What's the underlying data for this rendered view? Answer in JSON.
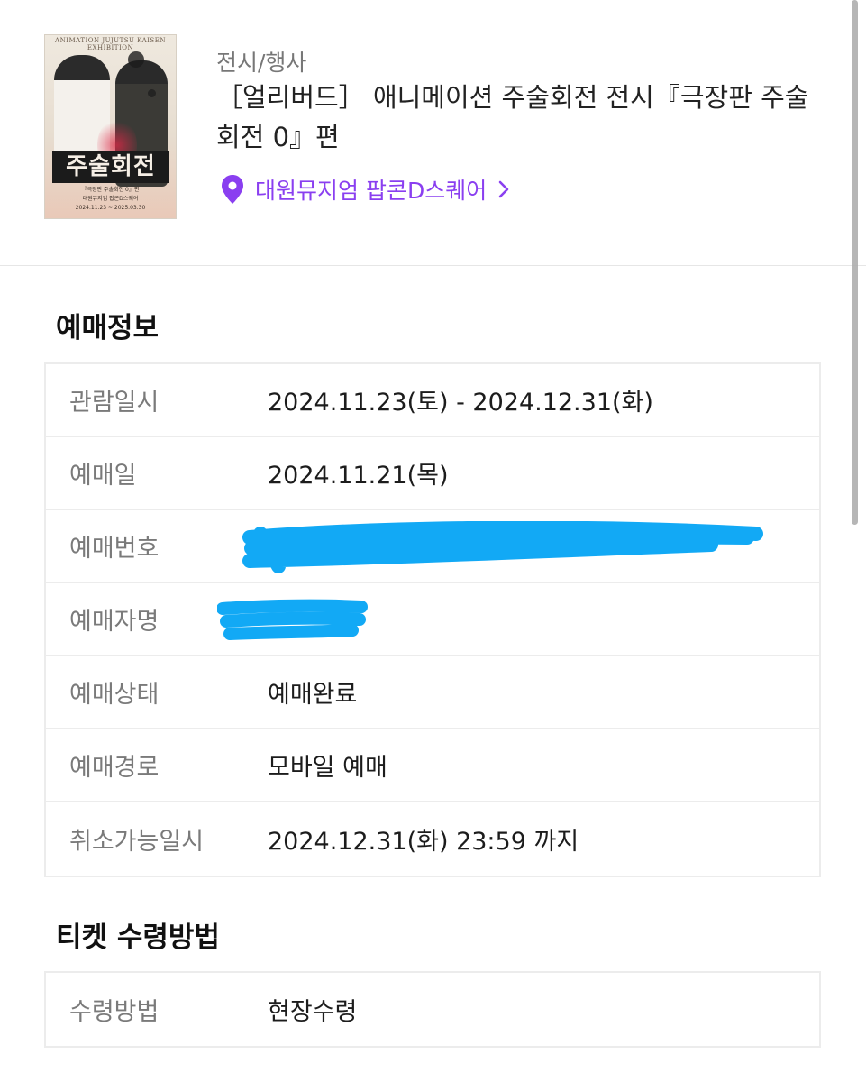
{
  "header": {
    "poster": {
      "exhibition_text": "ANIMATION JUJUTSU KAISEN EXHIBITION",
      "title": "주술회전",
      "subtitle_1": "『극장판 주술회전 0』편",
      "subtitle_2": "대원뮤지엄 팝콘D스퀘어",
      "subtitle_3": "2024.11.23 ~ 2025.03.30"
    },
    "category": "전시/행사",
    "title": "［얼리버드］ 애니메이션 주술회전 전시『극장판 주술회전 0』편",
    "venue": "대원뮤지엄 팝콘D스퀘어",
    "accent_color": "#8a3ff0"
  },
  "booking_section": {
    "title": "예매정보",
    "rows": [
      {
        "label": "관람일시",
        "value": "2024.11.23(토) - 2024.12.31(화)"
      },
      {
        "label": "예매일",
        "value": "2024.11.21(목)"
      },
      {
        "label": "예매번호",
        "value": ""
      },
      {
        "label": "예매자명",
        "value": ""
      },
      {
        "label": "예매상태",
        "value": "예매완료"
      },
      {
        "label": "예매경로",
        "value": "모바일 예매"
      },
      {
        "label": "취소가능일시",
        "value": "2024.12.31(화) 23:59 까지"
      }
    ]
  },
  "ticket_section": {
    "title": "티켓 수령방법",
    "rows": [
      {
        "label": "수령방법",
        "value": "현장수령"
      }
    ]
  },
  "redaction_color": "#12a9f5"
}
